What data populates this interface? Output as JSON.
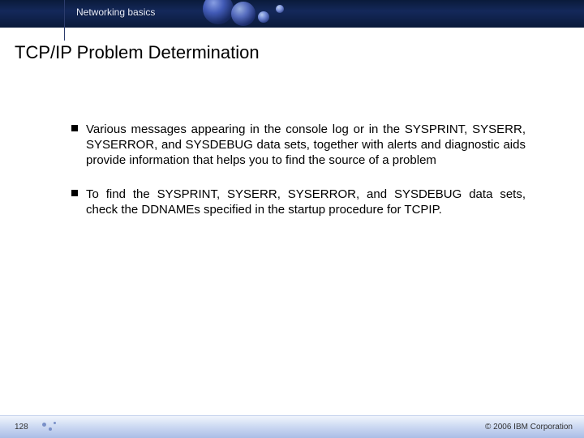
{
  "header": {
    "section_label": "Networking basics"
  },
  "title": "TCP/IP Problem Determination",
  "bullets": [
    "Various messages appearing in the console log or in the SYSPRINT, SYSERR, SYSERROR, and SYSDEBUG data sets, together with alerts and diagnostic aids provide information that helps you to find the source of a problem",
    "To find the SYSPRINT, SYSERR, SYSERROR, and SYSDEBUG data sets, check the DDNAMEs specified in the startup procedure for TCPIP."
  ],
  "footer": {
    "page_number": "128",
    "copyright": "© 2006 IBM Corporation"
  }
}
